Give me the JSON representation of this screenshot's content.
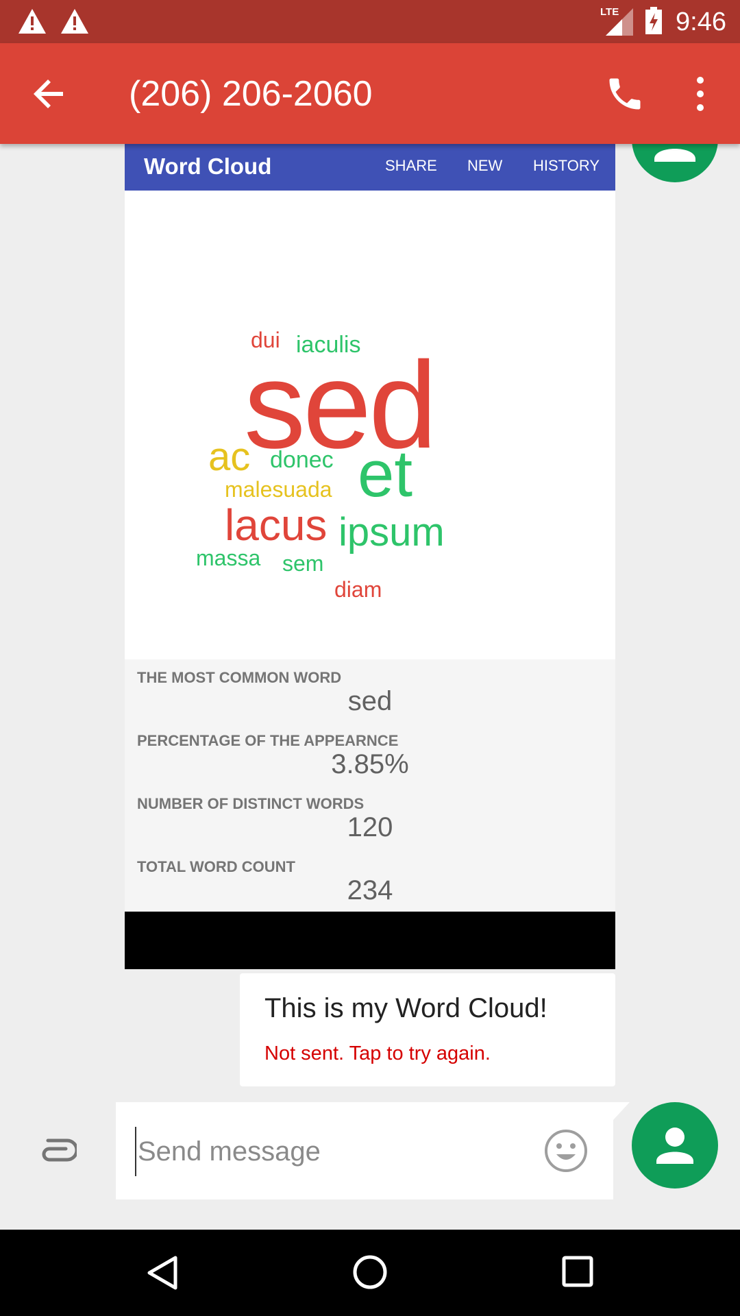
{
  "status_bar": {
    "time": "9:46",
    "network": "LTE",
    "icons": [
      "warning-icon",
      "warning-icon",
      "signal-icon",
      "battery-charging-icon"
    ]
  },
  "app_bar": {
    "title": "(206) 206-2060",
    "icons": [
      "back-arrow-icon",
      "phone-icon",
      "more-vert-icon"
    ]
  },
  "shared_image": {
    "app_title": "Word Cloud",
    "actions": [
      "SHARE",
      "NEW",
      "HISTORY"
    ],
    "cloud_words": [
      {
        "text": "dui",
        "color": "#e0453a"
      },
      {
        "text": "iaculis",
        "color": "#2ec46a"
      },
      {
        "text": "sed",
        "color": "#e0453a"
      },
      {
        "text": "ac",
        "color": "#e6c21f"
      },
      {
        "text": "donec",
        "color": "#2ec46a"
      },
      {
        "text": "et",
        "color": "#2ec46a"
      },
      {
        "text": "malesuada",
        "color": "#e6c21f"
      },
      {
        "text": "lacus",
        "color": "#e0453a"
      },
      {
        "text": "ipsum",
        "color": "#2ec46a"
      },
      {
        "text": "massa",
        "color": "#2ec46a"
      },
      {
        "text": "sem",
        "color": "#2ec46a"
      },
      {
        "text": "diam",
        "color": "#e0453a"
      }
    ],
    "stats": [
      {
        "label": "THE MOST COMMON WORD",
        "value": "sed"
      },
      {
        "label": "PERCENTAGE OF THE APPEARNCE",
        "value": "3.85%"
      },
      {
        "label": "NUMBER OF DISTINCT WORDS",
        "value": "120"
      },
      {
        "label": "TOTAL WORD COUNT",
        "value": "234"
      }
    ]
  },
  "message": {
    "text": "This is my Word Cloud!",
    "status": "Not sent. Tap to try again."
  },
  "compose": {
    "placeholder": "Send message",
    "value": ""
  },
  "colors": {
    "status_bar": "#a8352c",
    "app_bar": "#db4437",
    "word_cloud_bar": "#3f51b5",
    "avatar": "#0f9d58",
    "error_text": "#d50000"
  }
}
